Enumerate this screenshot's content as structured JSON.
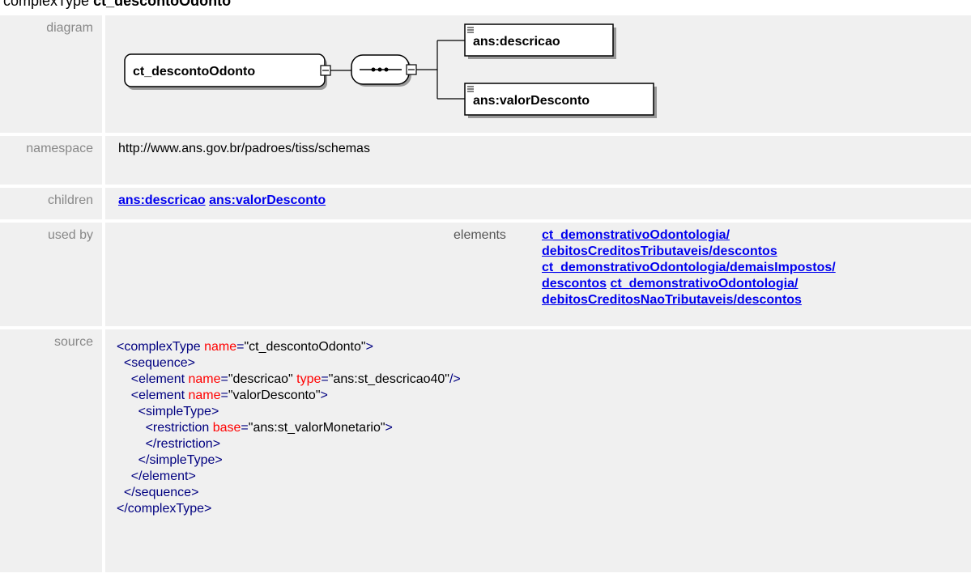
{
  "heading": {
    "prefix": "complexType",
    "name": "ct_descontoOdonto"
  },
  "labels": {
    "diagram": "diagram",
    "namespace": "namespace",
    "children": "children",
    "used_by": "used by",
    "source": "source"
  },
  "diagram": {
    "type_box": "ct_descontoOdonto",
    "child1": "ans:descricao",
    "child2": "ans:valorDesconto"
  },
  "namespace": "http://www.ans.gov.br/padroes/tiss/schemas",
  "children": [
    "ans:descricao",
    "ans:valorDesconto"
  ],
  "used_by": {
    "kind": "elements",
    "links": [
      [
        "ct_demonstrativoOdontologia/",
        "debitosCreditosTributaveis/descontos"
      ],
      [
        "ct_demonstrativoOdontologia/demaisImpostos/",
        "descontos"
      ],
      [
        "ct_demonstrativoOdontologia/",
        "debitosCreditosNaoTributaveis/descontos"
      ]
    ]
  },
  "source": {
    "l1_tag": "<complexType",
    "l1_attr": "name",
    "l1_val": "\"ct_descontoOdonto\"",
    "l1_end": ">",
    "l2": "<sequence>",
    "l3_tag": "<element",
    "l3_attr1": "name",
    "l3_val1": "\"descricao\"",
    "l3_attr2": "type",
    "l3_val2": "\"ans:st_descricao40\"",
    "l3_end": "/>",
    "l4_tag": "<element",
    "l4_attr": "name",
    "l4_val": "\"valorDesconto\"",
    "l4_end": ">",
    "l5": "<simpleType>",
    "l6_tag": "<restriction",
    "l6_attr": "base",
    "l6_val": "\"ans:st_valorMonetario\"",
    "l6_end": ">",
    "l7": "</restriction>",
    "l8": "</simpleType>",
    "l9": "</element>",
    "l10": "</sequence>",
    "l11": "</complexType>"
  }
}
